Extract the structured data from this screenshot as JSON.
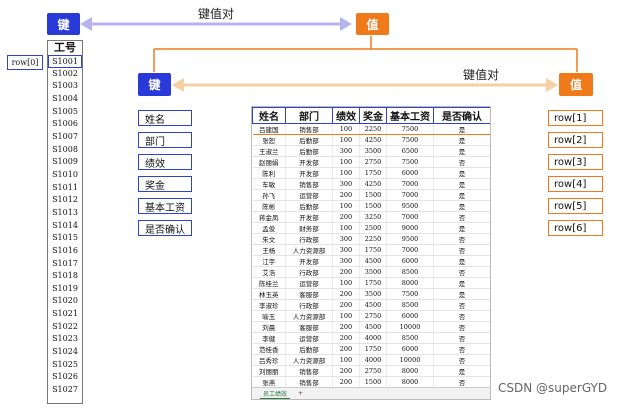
{
  "top_pair": {
    "key_label": "键",
    "value_label": "值",
    "caption": "键值对"
  },
  "row0_label": "row[0]",
  "id_column": {
    "header": "工号",
    "ids": [
      "S1001",
      "S1002",
      "S1003",
      "S1004",
      "S1005",
      "S1006",
      "S1007",
      "S1008",
      "S1009",
      "S1010",
      "S1011",
      "S1012",
      "S1013",
      "S1014",
      "S1015",
      "S1016",
      "S1017",
      "S1018",
      "S1019",
      "S1020",
      "S1021",
      "S1022",
      "S1023",
      "S1024",
      "S1025",
      "S1026",
      "S1027"
    ]
  },
  "inner_pair": {
    "key_label": "键",
    "value_label": "值",
    "caption": "键值对"
  },
  "fields": [
    "姓名",
    "部门",
    "绩效",
    "奖金",
    "基本工资",
    "是否确认"
  ],
  "rows": [
    "row[1]",
    "row[2]",
    "row[3]",
    "row[4]",
    "row[5]",
    "row[6]"
  ],
  "table": {
    "headers": [
      "姓名",
      "部门",
      "绩效",
      "奖金",
      "基本工资",
      "是否确认"
    ],
    "rows": [
      [
        "吕建国",
        "销售部",
        "100",
        "2250",
        "7500",
        "是"
      ],
      [
        "张恕",
        "后勤部",
        "100",
        "4250",
        "7500",
        "是"
      ],
      [
        "王淑兰",
        "后勤部",
        "300",
        "3500",
        "6500",
        "是"
      ],
      [
        "赵丽娟",
        "开发部",
        "100",
        "2750",
        "7500",
        "否"
      ],
      [
        "陈利",
        "开发部",
        "100",
        "1750",
        "6000",
        "是"
      ],
      [
        "车敏",
        "销售部",
        "300",
        "4250",
        "7000",
        "是"
      ],
      [
        "孙飞",
        "运营部",
        "200",
        "1500",
        "7000",
        "是"
      ],
      [
        "陈彬",
        "后勤部",
        "100",
        "1500",
        "9500",
        "是"
      ],
      [
        "蒋金凤",
        "开发部",
        "200",
        "3250",
        "7000",
        "否"
      ],
      [
        "孟俊",
        "财务部",
        "100",
        "2500",
        "9000",
        "是"
      ],
      [
        "朱文",
        "行政部",
        "300",
        "2250",
        "9500",
        "否"
      ],
      [
        "王杨",
        "人力资源部",
        "300",
        "1750",
        "7000",
        "否"
      ],
      [
        "江宇",
        "开发部",
        "300",
        "4500",
        "6000",
        "是"
      ],
      [
        "艾浩",
        "行政部",
        "200",
        "3500",
        "8500",
        "否"
      ],
      [
        "陈桂兰",
        "运营部",
        "100",
        "1750",
        "8000",
        "是"
      ],
      [
        "林玉英",
        "客服部",
        "200",
        "3500",
        "7500",
        "是"
      ],
      [
        "李淑珍",
        "行政部",
        "200",
        "4500",
        "8500",
        "否"
      ],
      [
        "喻玉",
        "人力资源部",
        "100",
        "2750",
        "6000",
        "否"
      ],
      [
        "刘晨",
        "客服部",
        "200",
        "4500",
        "10000",
        "否"
      ],
      [
        "李健",
        "运营部",
        "200",
        "4000",
        "8500",
        "否"
      ],
      [
        "范桂香",
        "后勤部",
        "200",
        "1750",
        "6000",
        "否"
      ],
      [
        "吕秀珍",
        "人力资源部",
        "100",
        "4000",
        "10000",
        "否"
      ],
      [
        "刘丽丽",
        "销售部",
        "200",
        "2750",
        "8000",
        "是"
      ],
      [
        "张燕",
        "销售部",
        "200",
        "1500",
        "8000",
        "否"
      ],
      [
        "崔慧",
        "客服部",
        "200",
        "2500",
        "8500",
        "否"
      ],
      [
        "梁彬",
        "销售部",
        "300",
        "2000",
        "10000",
        "否"
      ],
      [
        "陈敏",
        "行政部",
        "300",
        "4500",
        "6500",
        "否"
      ]
    ]
  },
  "sheet_tab": "员工绩效",
  "sheet_add": "+",
  "watermark": "CSDN @superGYD",
  "colors": {
    "key_blue": "#2a3ad8",
    "value_orange": "#f07a1a",
    "arrow_purple": "#b7b3ee",
    "arrow_orange": "#f6cfa6"
  }
}
